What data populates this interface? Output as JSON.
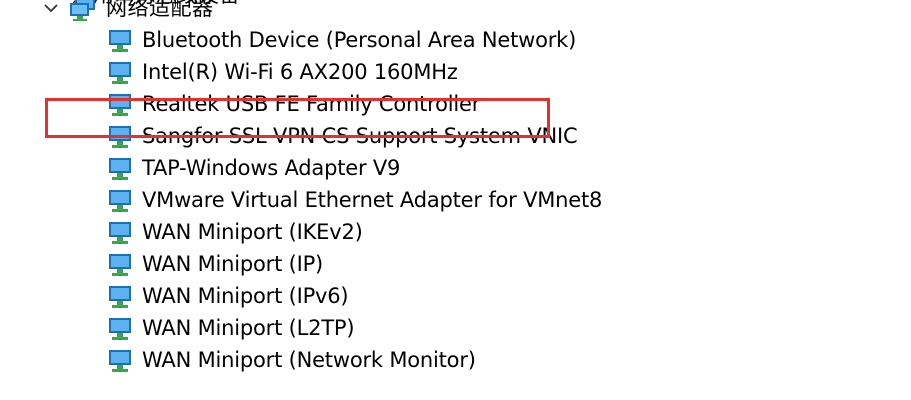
{
  "partial_category": {
    "label": "通用串行总线设备"
  },
  "category": {
    "label": "网络适配器",
    "expanded": true
  },
  "devices": [
    {
      "label": "Bluetooth Device (Personal Area Network)"
    },
    {
      "label": "Intel(R) Wi-Fi 6 AX200 160MHz"
    },
    {
      "label": "Realtek USB FE Family Controller"
    },
    {
      "label": "Sangfor SSL VPN CS Support System VNIC"
    },
    {
      "label": "TAP-Windows Adapter V9"
    },
    {
      "label": "VMware Virtual Ethernet Adapter for VMnet8"
    },
    {
      "label": "WAN Miniport (IKEv2)"
    },
    {
      "label": "WAN Miniport (IP)"
    },
    {
      "label": "WAN Miniport (IPv6)"
    },
    {
      "label": "WAN Miniport (L2TP)"
    },
    {
      "label": "WAN Miniport (Network Monitor)"
    }
  ],
  "icons": {
    "chevron": "chevron-down-icon",
    "device": "network-adapter-icon"
  },
  "colors": {
    "highlight": "#e0332f",
    "monitor_blue": "#2f8fd8",
    "connector_green": "#3aa64a"
  }
}
